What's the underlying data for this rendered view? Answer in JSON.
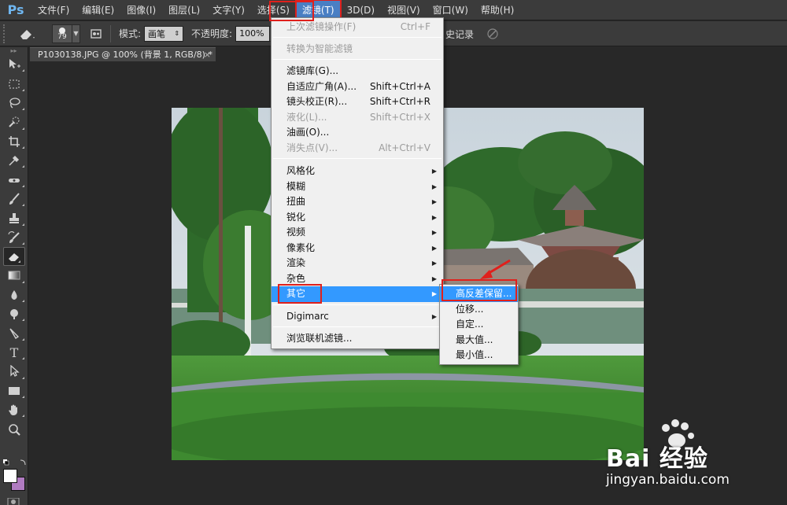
{
  "app": {
    "logo": "Ps"
  },
  "menubar": {
    "items": [
      "文件(F)",
      "编辑(E)",
      "图像(I)",
      "图层(L)",
      "文字(Y)",
      "选择(S)",
      "滤镜(T)",
      "3D(D)",
      "视图(V)",
      "窗口(W)",
      "帮助(H)"
    ]
  },
  "options": {
    "brush_size": "79",
    "mode_label": "模式:",
    "mode_value": "画笔",
    "opacity_label": "不透明度:",
    "opacity_value": "100%",
    "history_label": "史记录"
  },
  "document": {
    "tab_title": "P1030138.JPG @ 100% (背景 1, RGB/8) *",
    "close": "×"
  },
  "filter_menu": {
    "items": [
      {
        "label": "上次滤镜操作(F)",
        "shortcut": "Ctrl+F",
        "disabled": true
      },
      {
        "label": "转换为智能滤镜",
        "shortcut": "",
        "disabled": true
      },
      {
        "label": "滤镜库(G)...",
        "shortcut": "",
        "disabled": false
      },
      {
        "label": "自适应广角(A)...",
        "shortcut": "Shift+Ctrl+A",
        "disabled": false
      },
      {
        "label": "镜头校正(R)...",
        "shortcut": "Shift+Ctrl+R",
        "disabled": false
      },
      {
        "label": "液化(L)...",
        "shortcut": "Shift+Ctrl+X",
        "disabled": true
      },
      {
        "label": "油画(O)...",
        "shortcut": "",
        "disabled": false
      },
      {
        "label": "消失点(V)...",
        "shortcut": "Alt+Ctrl+V",
        "disabled": true
      },
      {
        "label": "风格化",
        "submenu": true
      },
      {
        "label": "模糊",
        "submenu": true
      },
      {
        "label": "扭曲",
        "submenu": true
      },
      {
        "label": "锐化",
        "submenu": true
      },
      {
        "label": "视频",
        "submenu": true
      },
      {
        "label": "像素化",
        "submenu": true
      },
      {
        "label": "渲染",
        "submenu": true
      },
      {
        "label": "杂色",
        "submenu": true
      },
      {
        "label": "其它",
        "submenu": true,
        "highlighted": true
      },
      {
        "label": "Digimarc",
        "submenu": true
      },
      {
        "label": "浏览联机滤镜..."
      }
    ]
  },
  "other_submenu": {
    "items": [
      "高反差保留...",
      "位移...",
      "自定...",
      "最大值...",
      "最小值..."
    ]
  },
  "watermark": {
    "brand": "Bai 经验",
    "url": "jingyan.baidu.com"
  },
  "colors": {
    "highlight": "#3399ff",
    "annotation": "#e0201c",
    "bg_swatch": "#b07bc1"
  }
}
